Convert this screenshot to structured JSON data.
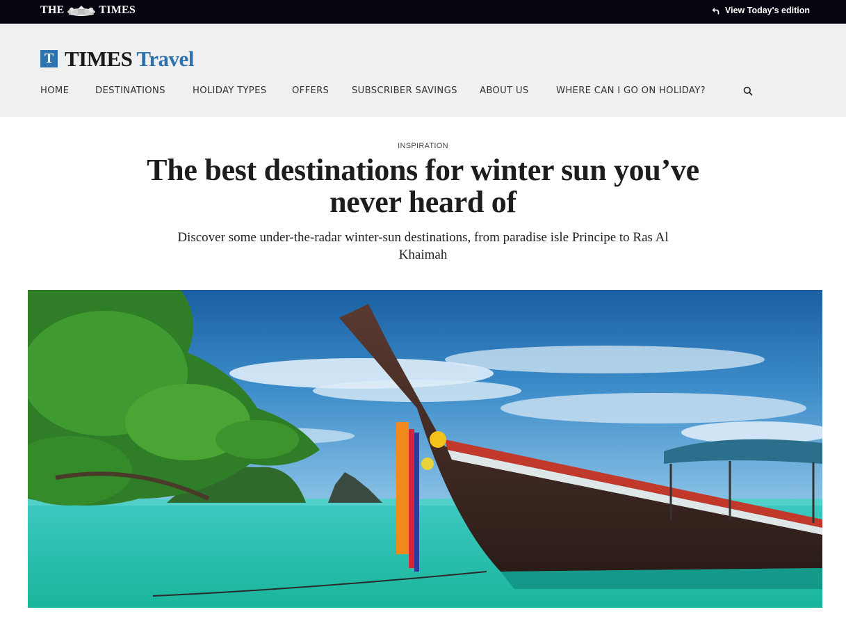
{
  "topbar": {
    "masthead_left": "THE",
    "masthead_right": "TIMES",
    "edition_label": "View Today's edition",
    "icons": {
      "crest": "royal-crest-icon",
      "edition": "curved-arrow-icon"
    }
  },
  "logo": {
    "badge": "T",
    "times": "TIMES",
    "travel": "Travel"
  },
  "nav": {
    "items": [
      "HOME",
      "DESTINATIONS",
      "HOLIDAY TYPES",
      "OFFERS",
      "SUBSCRIBER SAVINGS",
      "ABOUT US",
      "WHERE CAN I GO ON HOLIDAY?"
    ],
    "search_icon": "search-icon"
  },
  "article": {
    "kicker": "INSPIRATION",
    "headline": "The best destinations for winter sun you’ve never heard of",
    "standfirst": "Discover some under-the-radar winter-sun destinations, from paradise isle Principe to Ras Al Khaimah"
  },
  "colors": {
    "topbar": "#05050f",
    "header": "#f0f0f1",
    "brand_blue": "#2e73ae"
  }
}
